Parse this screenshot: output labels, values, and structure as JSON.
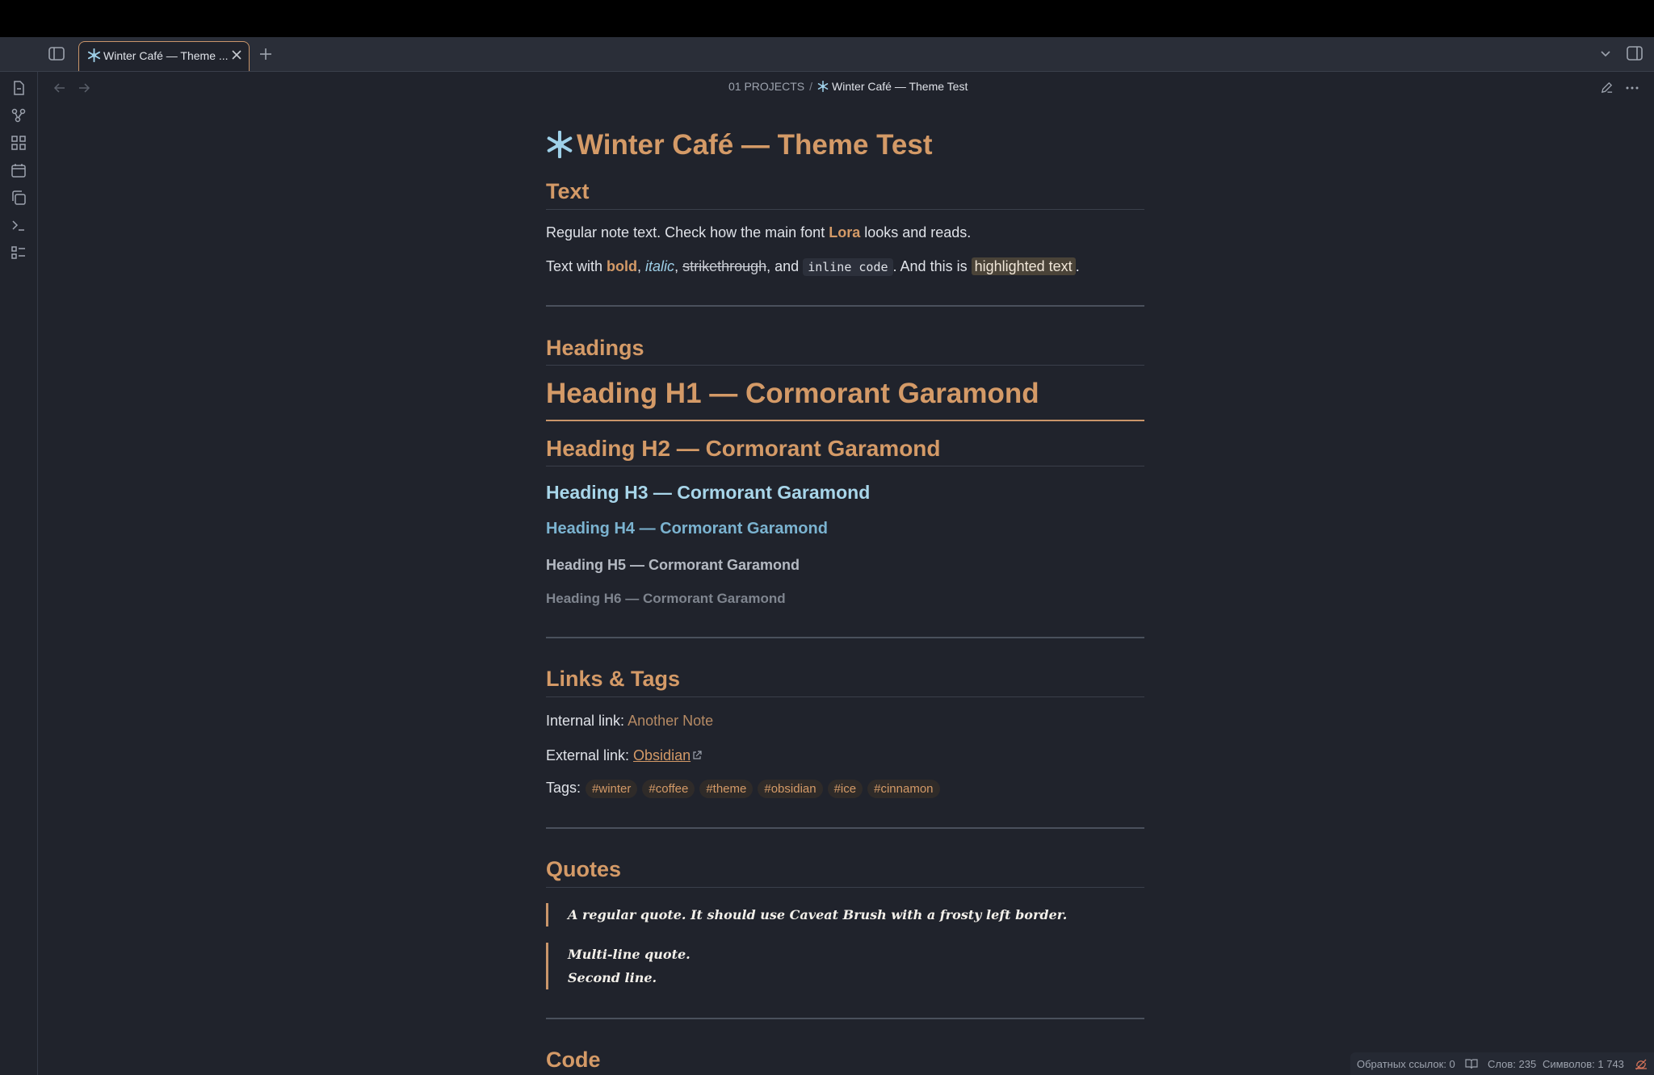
{
  "tab": {
    "title": "Winter Café — Theme ..."
  },
  "breadcrumb": {
    "folder": "01 PROJECTS",
    "separator": "/",
    "current": "Winter Café — Theme Test"
  },
  "document": {
    "title": "Winter Café — Theme Test",
    "sections": {
      "text": "Text",
      "headings": "Headings",
      "links": "Links & Tags",
      "quotes": "Quotes",
      "code": "Code"
    },
    "text_para1": {
      "before": "Regular note text. Check how the main font ",
      "font": "Lora",
      "after": " looks and reads."
    },
    "text_para2": {
      "p1": "Text with ",
      "bold": "bold",
      "c1": ", ",
      "italic": "italic",
      "c2": ", ",
      "strike": "strikethrough",
      "c3": ", and ",
      "code": "inline code",
      "c4": ". And this is ",
      "highlight": "highlighted text",
      "c5": "."
    },
    "headings": {
      "h1": "Heading H1 — Cormorant Garamond",
      "h2": "Heading H2 — Cormorant Garamond",
      "h3": "Heading H3 — Cormorant Garamond",
      "h4": "Heading H4 — Cormorant Garamond",
      "h5": "Heading H5 — Cormorant Garamond",
      "h6": "Heading H6 — Cormorant Garamond"
    },
    "links": {
      "internal_label": "Internal link: ",
      "internal_text": "Another Note",
      "external_label": "External link: ",
      "external_text": "Obsidian",
      "tags_label": "Tags:",
      "tags": [
        "#winter",
        "#coffee",
        "#theme",
        "#obsidian",
        "#ice",
        "#cinnamon"
      ]
    },
    "quotes": {
      "q1": "A regular quote. It should use Caveat Brush with a frosty left border.",
      "q2_line1": "Multi-line quote.",
      "q2_line2": "Second line."
    }
  },
  "statusbar": {
    "backlinks": "Обратных ссылок: 0",
    "words": "Слов: 235",
    "chars": "Символов: 1 743"
  },
  "colors": {
    "accent": "#d49a67",
    "background": "#20232c",
    "h3": "#a8d6ea",
    "h4": "#7bb3d0"
  }
}
